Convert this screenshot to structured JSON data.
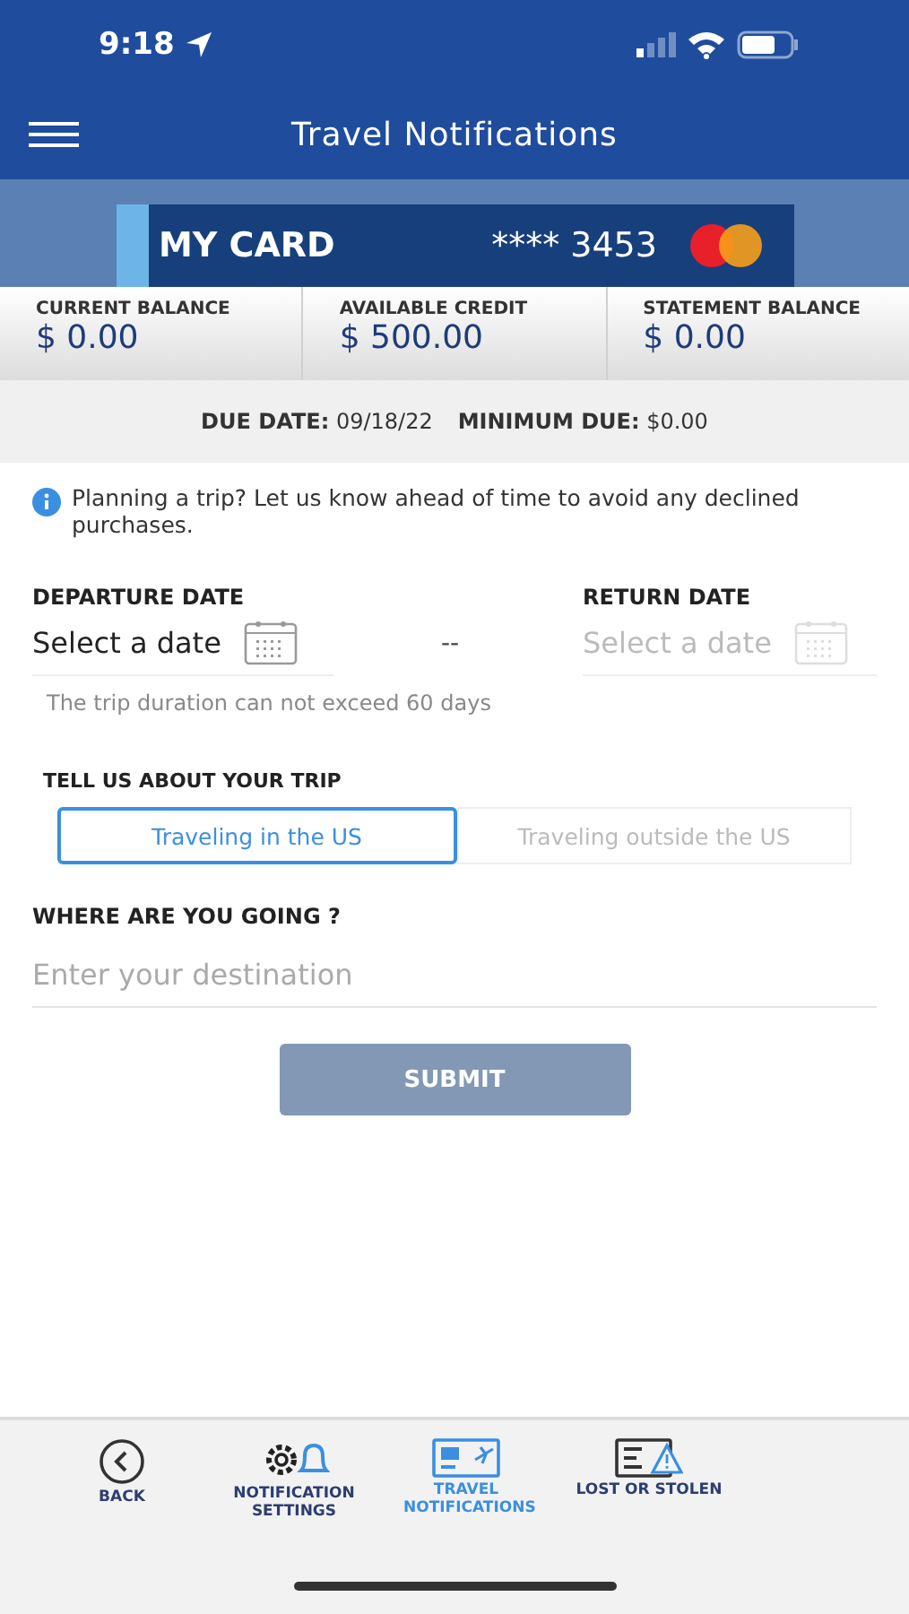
{
  "status_bar": {
    "time": "9:18"
  },
  "header": {
    "title": "Travel Notifications"
  },
  "card": {
    "name": "MY CARD",
    "number": "**** 3453"
  },
  "balances": [
    {
      "label": "CURRENT BALANCE",
      "value": "$ 0.00"
    },
    {
      "label": "AVAILABLE CREDIT",
      "value": "$ 500.00"
    },
    {
      "label": "STATEMENT BALANCE",
      "value": "$ 0.00"
    }
  ],
  "due": {
    "due_label": "DUE DATE:",
    "due_value": "09/18/22",
    "min_label": "MINIMUM DUE:",
    "min_value": "$0.00"
  },
  "info": "Planning a trip? Let us know ahead of time to avoid any declined purchases.",
  "departure": {
    "label": "DEPARTURE DATE",
    "placeholder": "Select a date",
    "disabled": false
  },
  "separator": "--",
  "return": {
    "label": "RETURN DATE",
    "placeholder": "Select a date",
    "disabled": true
  },
  "duration_hint": "The trip duration can not exceed 60 days",
  "trip_label": "TELL US ABOUT YOUR TRIP",
  "trip_options": [
    {
      "label": "Traveling in the US",
      "selected": true
    },
    {
      "label": "Traveling outside the US",
      "selected": false
    }
  ],
  "destination": {
    "label": "WHERE ARE YOU GOING ?",
    "placeholder": "Enter your destination"
  },
  "submit": {
    "label": "SUBMIT",
    "disabled": true
  },
  "nav": [
    {
      "kind": "back",
      "label": "BACK",
      "selected": false
    },
    {
      "kind": "settings",
      "label": "NOTIFICATION SETTINGS",
      "selected": false
    },
    {
      "kind": "travel",
      "label": "TRAVEL NOTIFICATIONS",
      "selected": true
    },
    {
      "kind": "lost",
      "label": "LOST OR STOLEN",
      "selected": false
    }
  ]
}
